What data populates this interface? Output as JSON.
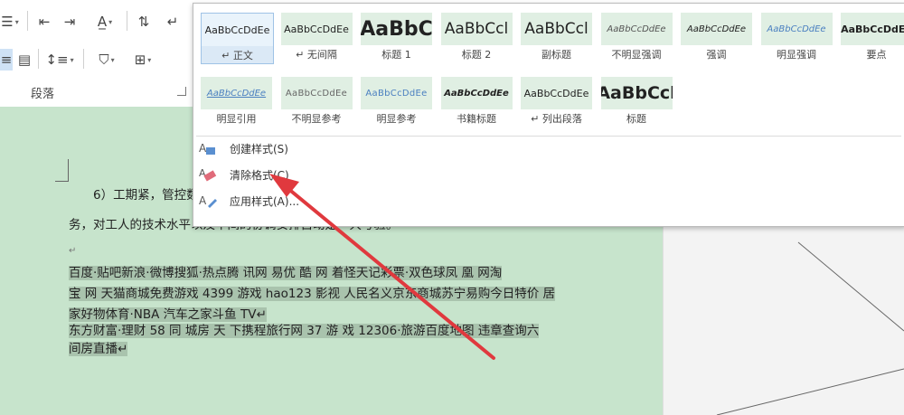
{
  "ribbon": {
    "paragraph_group_label": "段落"
  },
  "gallery": {
    "row1": [
      {
        "preview": "AaBbCcDdEe",
        "name": "↵ 正文",
        "selected": true
      },
      {
        "preview": "AaBbCcDdEe",
        "name": "↵ 无间隔"
      },
      {
        "preview": "AaBbC",
        "name": "标题 1"
      },
      {
        "preview": "AaBbCcl",
        "name": "标题 2"
      },
      {
        "preview": "AaBbCcl",
        "name": "副标题"
      },
      {
        "preview": "AaBbCcDdEe",
        "name": "不明显强调"
      },
      {
        "preview": "AaBbCcDdEe",
        "name": "强调"
      },
      {
        "preview": "AaBbCcDdEe",
        "name": "明显强调"
      },
      {
        "preview": "AaBbCcDdEe",
        "name": "要点"
      }
    ],
    "row2": [
      {
        "preview": "AaBbCcDdEe",
        "name": "明显引用"
      },
      {
        "preview": "AaBbCcDdEe",
        "name": "不明显参考"
      },
      {
        "preview": "AaBbCcDdEe",
        "name": "明显参考"
      },
      {
        "preview": "AaBbCcDdEe",
        "name": "书籍标题"
      },
      {
        "preview": "AaBbCcDdEe",
        "name": "↵ 列出段落"
      },
      {
        "preview": "AaBbCcl",
        "name": "标题"
      }
    ],
    "menu": {
      "create_style": "创建样式(S)",
      "clear_format": "清除格式(C)",
      "apply_style": "应用样式(A)..."
    }
  },
  "document": {
    "line1_visible": "6）工期紧，管控数",
    "line2_visible": "务，对工人的技术水平以及中间的协调安排自动是一大考验。",
    "line3_mark": "↵",
    "paragraph2": [
      "百度·贴吧新浪·微博搜狐·热点腾   讯网   易优  酷  网  着怪天记彩票·双色球凤  凰  网淘",
      "宝  网  天猫商城免费游戏  4399  游戏  hao123  影视  人民名义京东商城苏宁易购今日特价  居",
      "家好物体育·NBA 汽车之家斗鱼  TV↵",
      "东方财富·理财  58  同  城房  天  下携程旅行网  37  游  戏  12306·旅游百度地图  违章查询六",
      "间房直播↵"
    ]
  },
  "colors": {
    "page_background": "#c7e4cc",
    "highlight": "#a9c3ad",
    "arrow": "#e0393e"
  }
}
